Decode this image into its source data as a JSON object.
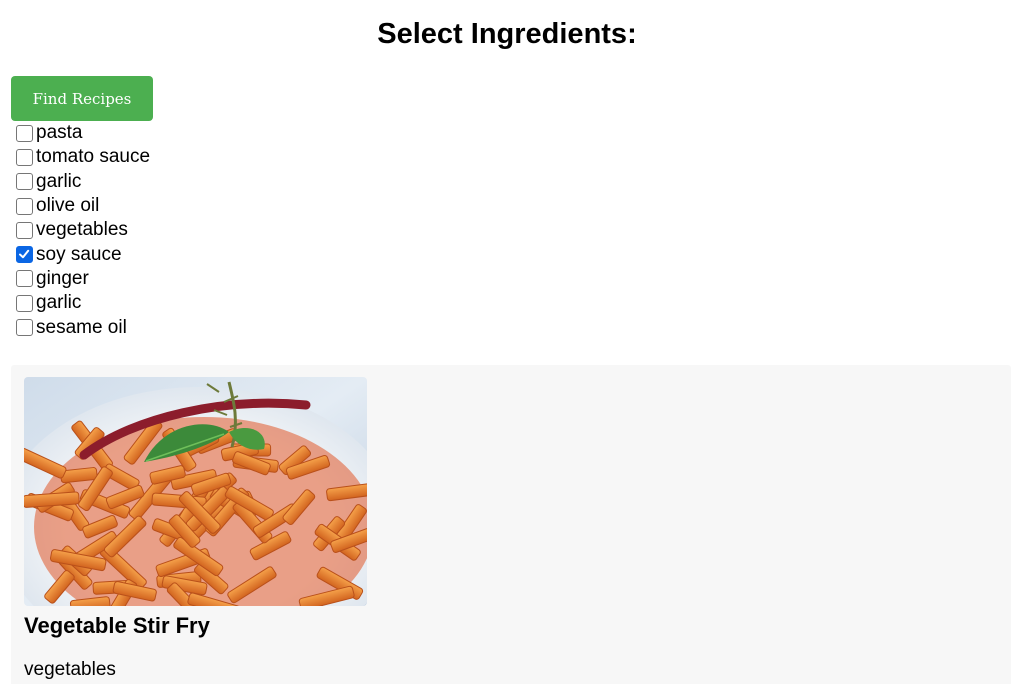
{
  "page": {
    "title": "Select Ingredients:"
  },
  "toolbar": {
    "find_label": "Find Recipes",
    "accent_color": "#4caf50"
  },
  "ingredients": [
    {
      "label": "pasta",
      "checked": false
    },
    {
      "label": "tomato sauce",
      "checked": false
    },
    {
      "label": "garlic",
      "checked": false
    },
    {
      "label": "olive oil",
      "checked": false
    },
    {
      "label": "vegetables",
      "checked": false
    },
    {
      "label": "soy sauce",
      "checked": true
    },
    {
      "label": "ginger",
      "checked": false
    },
    {
      "label": "garlic",
      "checked": false
    },
    {
      "label": "sesame oil",
      "checked": false
    }
  ],
  "results": {
    "recipes": [
      {
        "name": "Vegetable Stir Fry",
        "image": "penne-pasta-dish-photo",
        "ingredients_text": "vegetables"
      }
    ]
  }
}
